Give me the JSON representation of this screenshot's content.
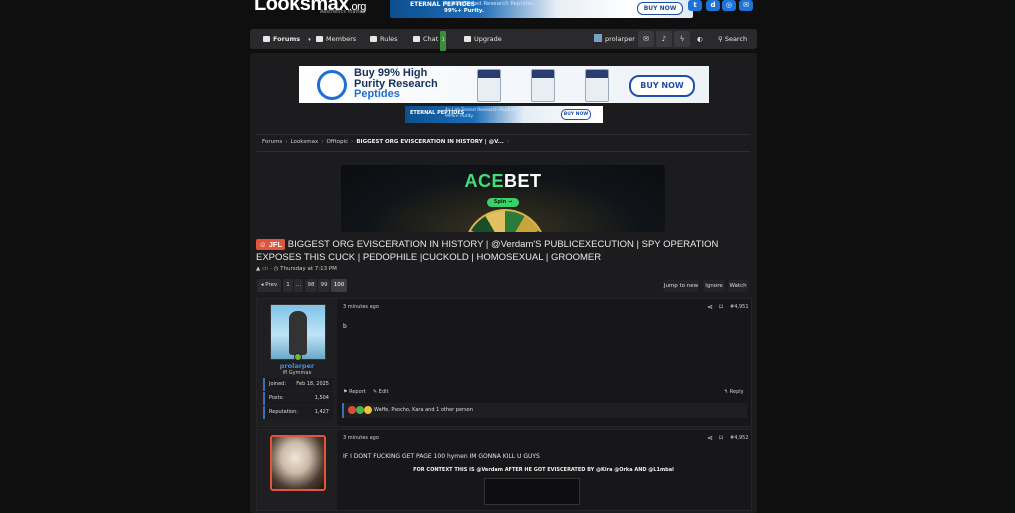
{
  "site": {
    "logo": "Looksmax",
    "logo_suffix": ".org",
    "tagline": "Aesthetics matter."
  },
  "top_banner": {
    "brand": "ETERNAL PEPTIDES",
    "line1": "4x Lab-Tested Research Peptides.",
    "line2": "99%+ Purity.",
    "cta": "BUY NOW"
  },
  "social": [
    {
      "icon": "twitter-icon",
      "glyph": "t"
    },
    {
      "icon": "discord-icon",
      "glyph": "d"
    },
    {
      "icon": "instagram-icon",
      "glyph": "◎"
    },
    {
      "icon": "mail-icon",
      "glyph": "✉"
    }
  ],
  "nav": {
    "forums": "Forums",
    "members": "Members",
    "rules": "Rules",
    "chat": "Chat",
    "chat_badge": "1",
    "upgrade": "Upgrade",
    "user": "prolarper",
    "search": "Search"
  },
  "ad_main": {
    "line1": "Buy 99% High",
    "line2": "Purity Research",
    "line3": "Peptides",
    "cta": "BUY NOW"
  },
  "ad_small": {
    "brand": "ETERNAL PEPTIDES",
    "line1": "4x Lab-Tested Research Peptides.",
    "line2": "99%+ Purity.",
    "cta": "BUY NOW"
  },
  "breadcrumb": {
    "items": [
      "Forums",
      "Looksmax",
      "Offtopic"
    ],
    "current": "BIGGEST ORG EVISCERATION IN HISTORY | @V..."
  },
  "acebet": {
    "name_a": "ACE",
    "name_b": "BET",
    "spin": "Spin →"
  },
  "thread": {
    "prefix": "JFL",
    "title": "BIGGEST ORG EVISCERATION IN HISTORY | @Verdam'S PUBLICEXECUTION | SPY OPERATION EXPOSES THIS CUCK | PEDOPHILE |CUCKOLD | HOMOSEXUAL | GROOMER",
    "author": "sb",
    "date": "Thursday at 7:13 PM"
  },
  "pagination": {
    "prev": "◂ Prev",
    "pages": [
      "1",
      "...",
      "98",
      "99",
      "100"
    ],
    "current": "100",
    "jump": "Jump to new",
    "ignore": "Ignore",
    "watch": "Watch"
  },
  "posts": [
    {
      "time": "3 minutes ago",
      "number": "#4,951",
      "body": "b",
      "username": "prolarper",
      "user_title": "Ifl Gymmax",
      "stats": [
        {
          "label": "Joined:",
          "value": "Feb 18, 2025"
        },
        {
          "label": "Posts:",
          "value": "1,504"
        },
        {
          "label": "Reputation:",
          "value": "1,427"
        }
      ],
      "report": "Report",
      "edit": "Edit",
      "reply": "Reply",
      "reactions": "Waffe, Psocho, Kara and 1 other person"
    },
    {
      "time": "3 minutes ago",
      "number": "#4,952",
      "body": "IF I DONT FUCKING GET PAGE 100 hymen IM GONNA KILL U GUYS",
      "context": "FOR CONTEXT THIS IS @Verdam AFTER HE GOT EVISCERATED BY @Kira @Orka AND @L1mbal"
    }
  ],
  "colors": {
    "accent_blue": "#3d8ee0",
    "prefix_red": "#e0553c",
    "background": "#0f0f10"
  }
}
